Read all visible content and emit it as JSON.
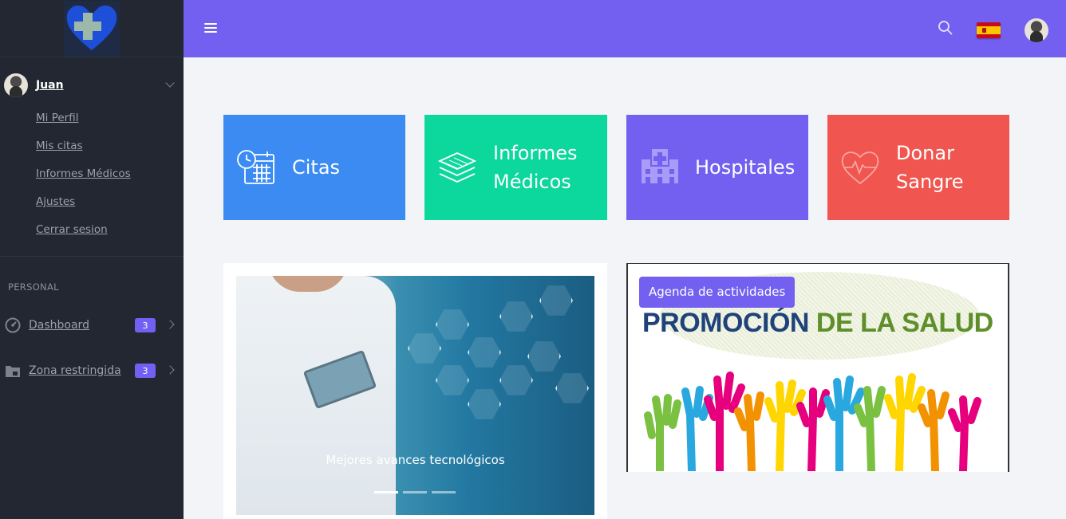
{
  "sidebar": {
    "user": {
      "name": "Juan"
    },
    "user_menu": [
      "Mi Perfil",
      "Mis citas",
      "Informes Médicos",
      "Ajustes",
      "Cerrar sesion"
    ],
    "section_label": "PERSONAL",
    "nav": [
      {
        "label": "Dashboard",
        "badge": "3",
        "icon": "dashboard-icon"
      },
      {
        "label": "Zona restringida",
        "badge": "3",
        "icon": "folder-lock-icon"
      }
    ]
  },
  "header": {
    "icons": [
      "menu-icon",
      "search-icon",
      "spain-flag",
      "avatar"
    ]
  },
  "tiles": [
    {
      "label": "Citas",
      "icon": "calendar-clock-icon",
      "color": "#3b8bf2"
    },
    {
      "label": "Informes Médicos",
      "icon": "layers-icon",
      "color": "#0cd79c"
    },
    {
      "label": "Hospitales",
      "icon": "hospital-icon",
      "color": "#7360f0"
    },
    {
      "label": "Donar Sangre",
      "icon": "heart-pulse-icon",
      "color": "#f0564f"
    }
  ],
  "carousel": {
    "caption": "Mejores avances tecnológicos",
    "slides": 3,
    "active_slide": 1
  },
  "promo": {
    "badge": "Agenda de actividades",
    "title_part1": "PROMOCIÓN",
    "title_part2": "DE LA SALUD"
  },
  "colors": {
    "accent": "#7360f0",
    "sidebar_bg": "#222731"
  }
}
